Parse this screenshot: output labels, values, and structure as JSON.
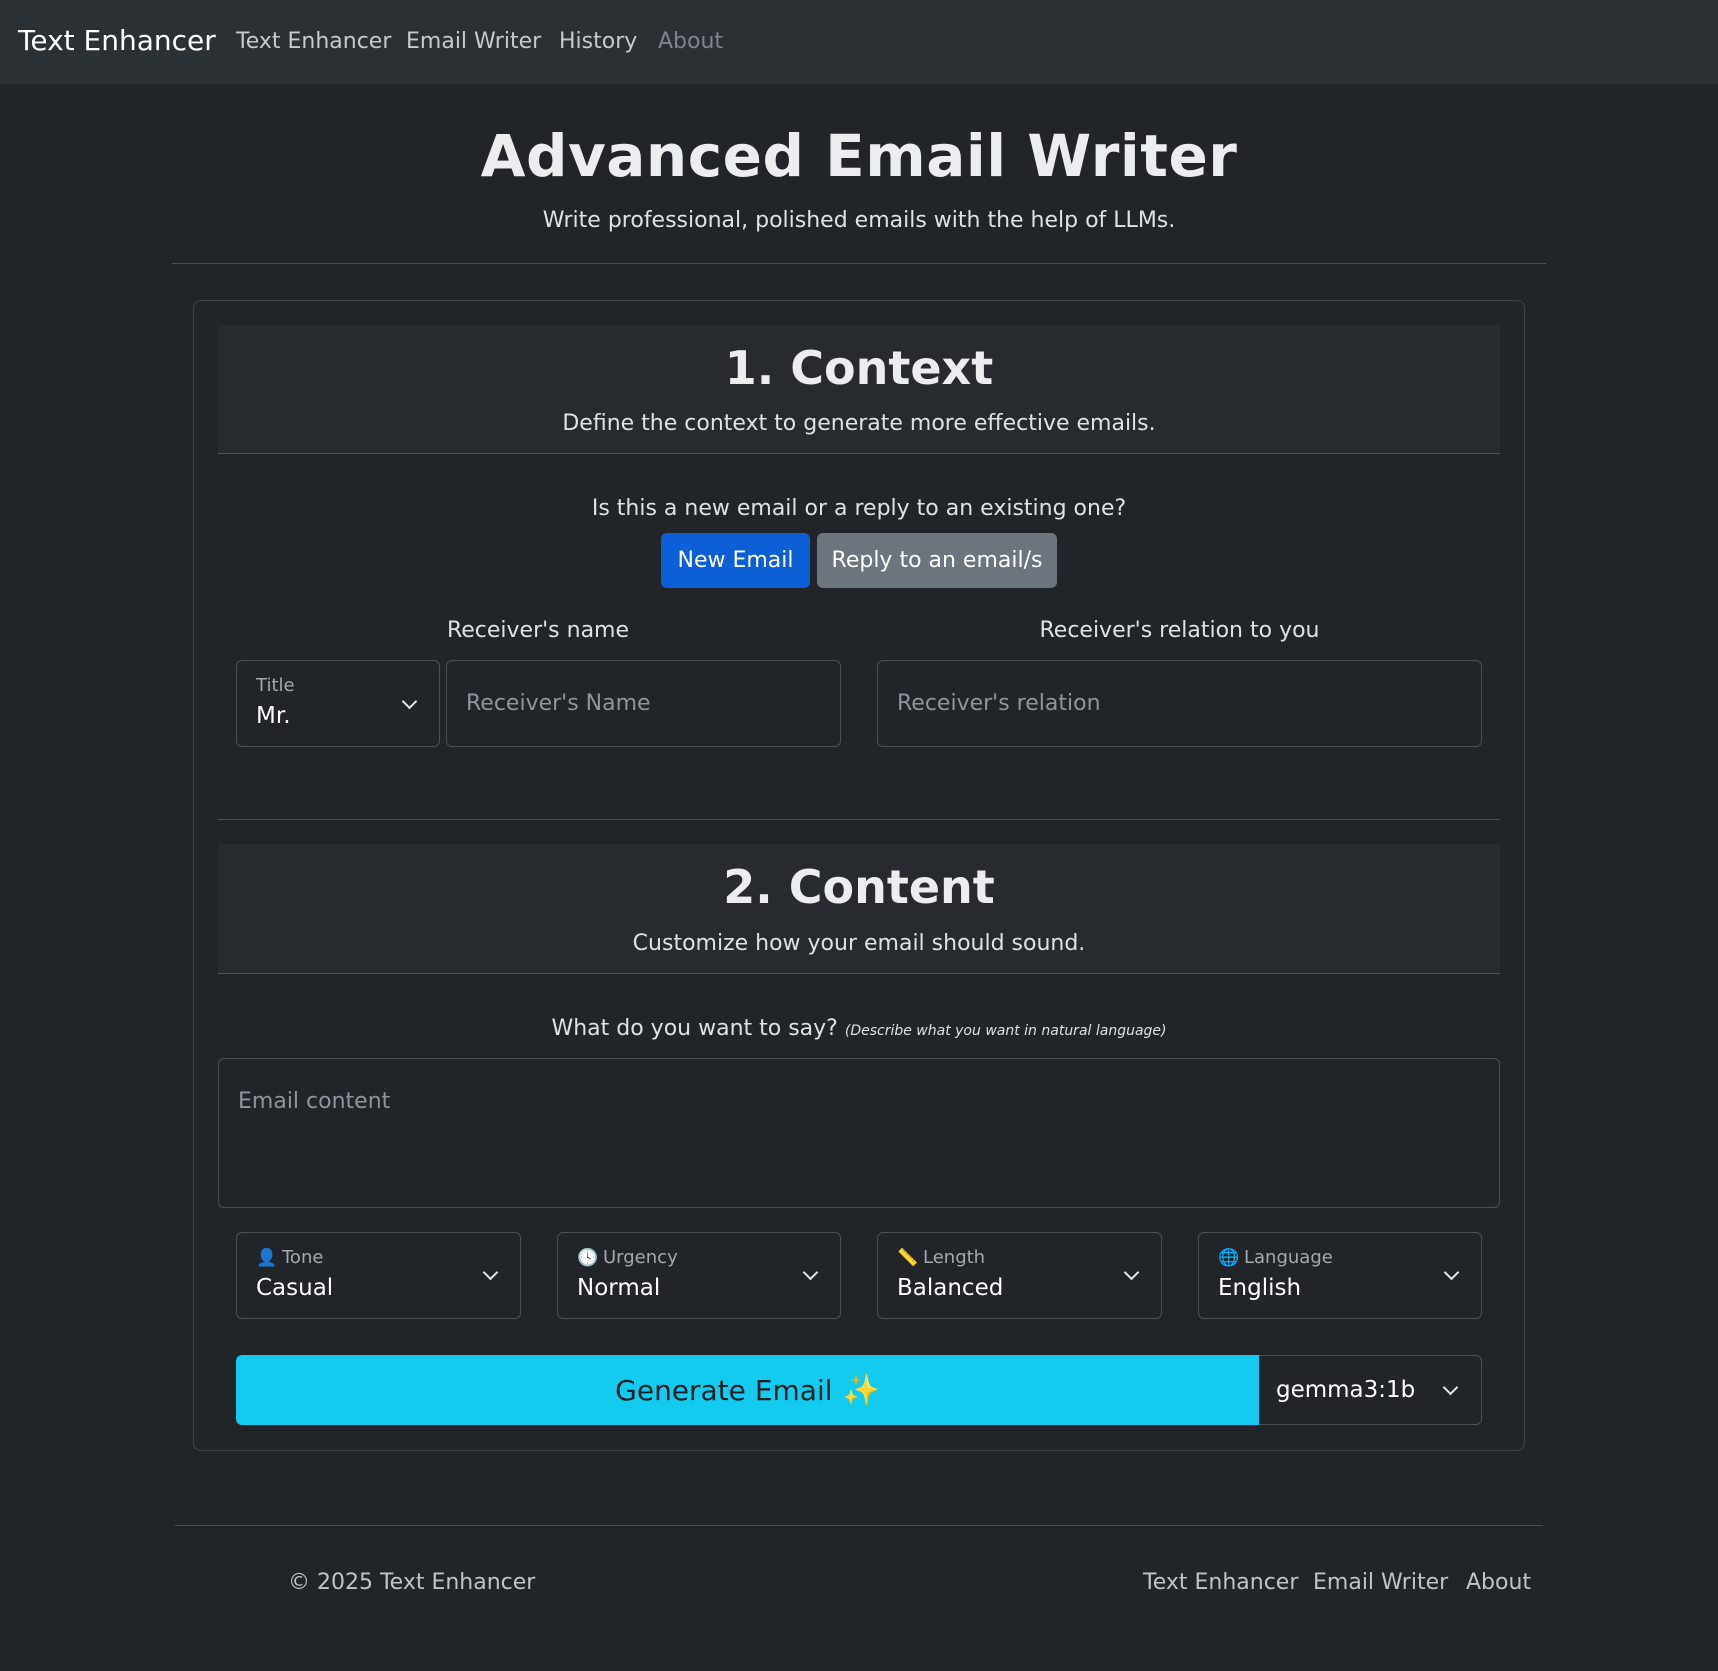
{
  "navbar": {
    "brand": "Text Enhancer",
    "links": [
      "Text Enhancer",
      "Email Writer",
      "History",
      "About"
    ]
  },
  "header": {
    "title": "Advanced Email Writer",
    "subtitle": "Write professional, polished emails with the help of LLMs."
  },
  "context": {
    "title": "1. Context",
    "description": "Define the context to generate more effective emails.",
    "question": "Is this a new email or a reply to an existing one?",
    "new_email_label": "New Email",
    "reply_label": "Reply to an email/s",
    "receiver_name_label": "Receiver's name",
    "receiver_relation_label": "Receiver's relation to you",
    "title_select_label": "Title",
    "title_select_value": "Mr.",
    "name_placeholder": "Receiver's Name",
    "relation_placeholder": "Receiver's relation"
  },
  "content": {
    "title": "2. Content",
    "description": "Customize how your email should sound.",
    "prompt_label": "What do you want to say?",
    "prompt_hint": "(Describe what you want in natural language)",
    "email_placeholder": "Email content",
    "selects": [
      {
        "label": "Tone",
        "value": "Casual",
        "icon": "person-icon"
      },
      {
        "label": "Urgency",
        "value": "Normal",
        "icon": "clock-icon"
      },
      {
        "label": "Length",
        "value": "Balanced",
        "icon": "ruler-icon"
      },
      {
        "label": "Language",
        "value": "English",
        "icon": "globe-icon"
      }
    ],
    "generate_label": "Generate Email",
    "model_value": "gemma3:1b"
  },
  "footer": {
    "copyright": "© 2025 Text Enhancer",
    "links": [
      "Text Enhancer",
      "Email Writer",
      "About"
    ]
  },
  "colors": {
    "background": "#212529",
    "navbar": "#2b3035",
    "primary": "#0d5fd6",
    "secondary": "#6c757d",
    "accent": "#12cbee"
  }
}
